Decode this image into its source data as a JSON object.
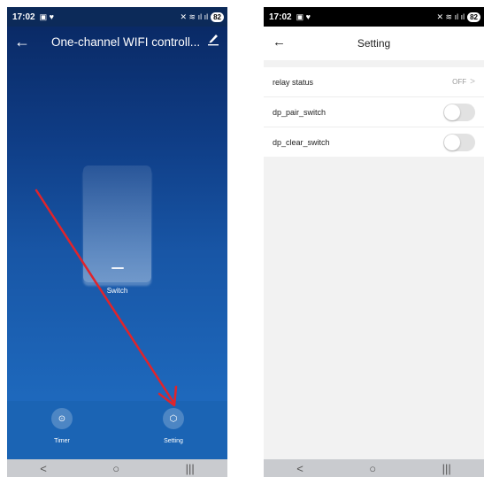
{
  "left_screen": {
    "status": {
      "time": "17:02",
      "icons_left": "▣ ♥",
      "icons_right": "✕ ≋ ıl ıl",
      "battery": "82"
    },
    "header": {
      "title": "One-channel WIFI controll...",
      "back_icon": "←",
      "edit_icon": "pencil-icon"
    },
    "switch_label": "Switch",
    "tabs": [
      {
        "label": "Timer",
        "icon": "⊙"
      },
      {
        "label": "Setting",
        "icon": "⬡"
      }
    ],
    "nav": {
      "back": "<",
      "home": "○",
      "recents": "|||"
    }
  },
  "right_screen": {
    "status": {
      "time": "17:02",
      "icons_left": "▣ ♥",
      "icons_right": "✕ ≋ ıl ıl",
      "battery": "82"
    },
    "header": {
      "title": "Setting",
      "back_icon": "←"
    },
    "rows": [
      {
        "label": "relay status",
        "value": "OFF",
        "chevron": ">"
      },
      {
        "label": "dp_pair_switch",
        "toggle": false
      },
      {
        "label": "dp_clear_switch",
        "toggle": false
      }
    ],
    "nav": {
      "back": "<",
      "home": "○",
      "recents": "|||"
    }
  },
  "colors": {
    "arrow": "#e0242b",
    "tab_bar": "#1b64b4",
    "header_bg": "#0a2a66"
  }
}
